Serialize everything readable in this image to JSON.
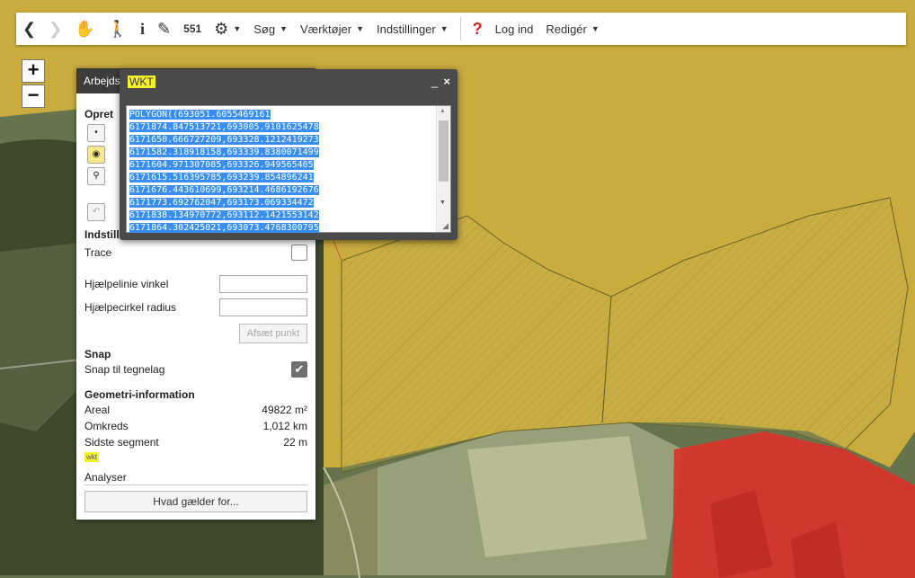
{
  "toolbar": {
    "back_icon": "chevron-left-icon",
    "forward_icon": "chevron-right-icon",
    "items": [
      {
        "name": "pan-tool",
        "icon": "hand-icon",
        "glyph": "✋"
      },
      {
        "name": "identify-tool",
        "icon": "info-pointer-icon",
        "glyph": "🚶"
      },
      {
        "name": "info-tool",
        "icon": "info-icon",
        "glyph": "i"
      },
      {
        "name": "measure-tool",
        "icon": "ruler-icon",
        "glyph": "✎"
      },
      {
        "name": "scale-tool",
        "icon": "scale-icon",
        "glyph": "551"
      },
      {
        "name": "layers-tool",
        "icon": "layers-icon",
        "glyph": "⚙"
      }
    ],
    "menu": {
      "search": "Søg",
      "tools": "Værktøjer",
      "settings": "Indstillinger"
    },
    "help_icon": "question-icon",
    "login": "Log ind",
    "edit": "Redigér"
  },
  "zoom": {
    "in": "+",
    "out": "−"
  },
  "panel": {
    "title": "Arbejds",
    "opret": "Opret",
    "settings_title": "Indstill",
    "trace_label": "Trace",
    "trace_checked": false,
    "angle_label": "Hjælpelinie vinkel",
    "angle_value": "",
    "radius_label": "Hjælpecirkel radius",
    "radius_value": "",
    "afsaet_button": "Afsæt punkt",
    "snap_title": "Snap",
    "snap_label": "Snap til tegnelag",
    "snap_checked": true,
    "geo_title": "Geometri-information",
    "area_label": "Areal",
    "area_value": "49822 m²",
    "perimeter_label": "Omkreds",
    "perimeter_value": "1,012 km",
    "segment_label": "Sidste segment",
    "segment_value": "22 m",
    "wkt_link": "wkt",
    "analyses_title": "Analyser",
    "analyses_button": "Hvad gælder for..."
  },
  "dialog": {
    "title": "WKT",
    "minimize": "_",
    "close": "×",
    "wkt_lines": [
      "POLYGON((693051.6055469161",
      "6171874.847513721,693005.9101625478",
      "6171650.666727209,693328.1212419273",
      "6171582.318918158,693339.8380071499",
      "6171604.971307085,693326.949565405",
      "6171615.516395785,693239.854896241",
      "6171676.443610699,693214.4686192676",
      "6171773.692762047,693173.069334472",
      "6171838.134970772,693112.1421553142",
      "6171864.302425021,693073.4768300795"
    ]
  },
  "colors": {
    "dialog_bg": "#4a4a4a",
    "selection": "#3b8ef1",
    "highlight": "#f6ef2e",
    "zone_yellow": "#d8b33c",
    "zone_red": "#d9332a",
    "toolbar_bg": "#ffffff"
  }
}
